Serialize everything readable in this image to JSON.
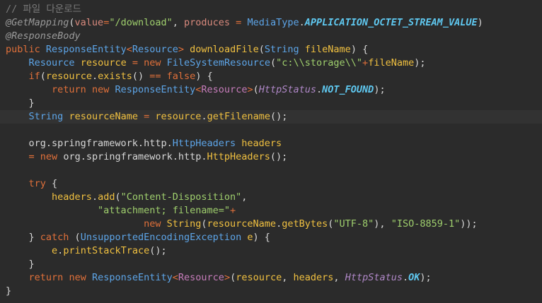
{
  "editor": {
    "lines": [
      [
        {
          "c": "t-comment",
          "t": "// 파일 다운로드"
        }
      ],
      [
        {
          "c": "t-annot",
          "t": "@GetMapping"
        },
        {
          "c": "t-plain",
          "t": "("
        },
        {
          "c": "t-param",
          "t": "value"
        },
        {
          "c": "t-op",
          "t": "="
        },
        {
          "c": "t-str",
          "t": "\"/download\""
        },
        {
          "c": "t-plain",
          "t": ", "
        },
        {
          "c": "t-param",
          "t": "produces"
        },
        {
          "c": "t-plain",
          "t": " "
        },
        {
          "c": "t-op",
          "t": "="
        },
        {
          "c": "t-plain",
          "t": " "
        },
        {
          "c": "t-type",
          "t": "MediaType"
        },
        {
          "c": "t-plain",
          "t": "."
        },
        {
          "c": "t-const",
          "t": "APPLICATION_OCTET_STREAM_VALUE"
        },
        {
          "c": "t-plain",
          "t": ")"
        }
      ],
      [
        {
          "c": "t-annot",
          "t": "@ResponseBody"
        }
      ],
      [
        {
          "c": "t-kw",
          "t": "public"
        },
        {
          "c": "t-plain",
          "t": " "
        },
        {
          "c": "t-type",
          "t": "ResponseEntity"
        },
        {
          "c": "t-op",
          "t": "<"
        },
        {
          "c": "t-type",
          "t": "Resource"
        },
        {
          "c": "t-op",
          "t": ">"
        },
        {
          "c": "t-plain",
          "t": " "
        },
        {
          "c": "t-method",
          "t": "downloadFile"
        },
        {
          "c": "t-plain",
          "t": "("
        },
        {
          "c": "t-type",
          "t": "String"
        },
        {
          "c": "t-plain",
          "t": " "
        },
        {
          "c": "t-var",
          "t": "fileName"
        },
        {
          "c": "t-plain",
          "t": ") {"
        }
      ],
      [
        {
          "c": "t-plain",
          "t": "    "
        },
        {
          "c": "t-type",
          "t": "Resource"
        },
        {
          "c": "t-plain",
          "t": " "
        },
        {
          "c": "t-var",
          "t": "resource"
        },
        {
          "c": "t-plain",
          "t": " "
        },
        {
          "c": "t-op",
          "t": "="
        },
        {
          "c": "t-plain",
          "t": " "
        },
        {
          "c": "t-kw",
          "t": "new"
        },
        {
          "c": "t-plain",
          "t": " "
        },
        {
          "c": "t-type",
          "t": "FileSystemResource"
        },
        {
          "c": "t-plain",
          "t": "("
        },
        {
          "c": "t-str",
          "t": "\"c:\\\\storage\\\\\""
        },
        {
          "c": "t-op",
          "t": "+"
        },
        {
          "c": "t-var",
          "t": "fileName"
        },
        {
          "c": "t-plain",
          "t": ");"
        }
      ],
      [
        {
          "c": "t-plain",
          "t": "    "
        },
        {
          "c": "t-kw",
          "t": "if"
        },
        {
          "c": "t-plain",
          "t": "("
        },
        {
          "c": "t-var",
          "t": "resource"
        },
        {
          "c": "t-plain",
          "t": "."
        },
        {
          "c": "t-method",
          "t": "exists"
        },
        {
          "c": "t-plain",
          "t": "() "
        },
        {
          "c": "t-op",
          "t": "=="
        },
        {
          "c": "t-plain",
          "t": " "
        },
        {
          "c": "t-kw",
          "t": "false"
        },
        {
          "c": "t-plain",
          "t": ") {"
        }
      ],
      [
        {
          "c": "t-plain",
          "t": "        "
        },
        {
          "c": "t-kw",
          "t": "return"
        },
        {
          "c": "t-plain",
          "t": " "
        },
        {
          "c": "t-kw",
          "t": "new"
        },
        {
          "c": "t-plain",
          "t": " "
        },
        {
          "c": "t-type",
          "t": "ResponseEntity"
        },
        {
          "c": "t-op",
          "t": "<"
        },
        {
          "c": "t-generic",
          "t": "Resource"
        },
        {
          "c": "t-op",
          "t": ">"
        },
        {
          "c": "t-plain",
          "t": "("
        },
        {
          "c": "t-static",
          "t": "HttpStatus"
        },
        {
          "c": "t-plain",
          "t": "."
        },
        {
          "c": "t-const",
          "t": "NOT_FOUND"
        },
        {
          "c": "t-plain",
          "t": ");"
        }
      ],
      [
        {
          "c": "t-plain",
          "t": "    }"
        }
      ],
      [
        {
          "c": "t-plain",
          "t": "    "
        },
        {
          "c": "t-type",
          "t": "String"
        },
        {
          "c": "t-plain",
          "t": " "
        },
        {
          "c": "t-var",
          "t": "resourceName"
        },
        {
          "c": "t-plain",
          "t": " "
        },
        {
          "c": "t-op",
          "t": "="
        },
        {
          "c": "t-plain",
          "t": " "
        },
        {
          "c": "t-var",
          "t": "resource"
        },
        {
          "c": "t-plain",
          "t": "."
        },
        {
          "c": "t-method",
          "t": "getFilename"
        },
        {
          "c": "t-plain",
          "t": "();"
        }
      ],
      [
        {
          "c": "t-plain",
          "t": ""
        }
      ],
      [
        {
          "c": "t-plain",
          "t": "    org.springframework.http."
        },
        {
          "c": "t-type",
          "t": "HttpHeaders"
        },
        {
          "c": "t-plain",
          "t": " "
        },
        {
          "c": "t-var",
          "t": "headers"
        }
      ],
      [
        {
          "c": "t-plain",
          "t": "    "
        },
        {
          "c": "t-op",
          "t": "="
        },
        {
          "c": "t-plain",
          "t": " "
        },
        {
          "c": "t-kw",
          "t": "new"
        },
        {
          "c": "t-plain",
          "t": " org.springframework.http."
        },
        {
          "c": "t-method",
          "t": "HttpHeaders"
        },
        {
          "c": "t-plain",
          "t": "();"
        }
      ],
      [
        {
          "c": "t-plain",
          "t": ""
        }
      ],
      [
        {
          "c": "t-plain",
          "t": "    "
        },
        {
          "c": "t-kw",
          "t": "try"
        },
        {
          "c": "t-plain",
          "t": " {"
        }
      ],
      [
        {
          "c": "t-plain",
          "t": "        "
        },
        {
          "c": "t-var",
          "t": "headers"
        },
        {
          "c": "t-plain",
          "t": "."
        },
        {
          "c": "t-method",
          "t": "add"
        },
        {
          "c": "t-plain",
          "t": "("
        },
        {
          "c": "t-str",
          "t": "\"Content-Disposition\""
        },
        {
          "c": "t-plain",
          "t": ","
        }
      ],
      [
        {
          "c": "t-plain",
          "t": "                "
        },
        {
          "c": "t-str",
          "t": "\"attachment; filename=\""
        },
        {
          "c": "t-op",
          "t": "+"
        }
      ],
      [
        {
          "c": "t-plain",
          "t": "                        "
        },
        {
          "c": "t-kw",
          "t": "new"
        },
        {
          "c": "t-plain",
          "t": " "
        },
        {
          "c": "t-method",
          "t": "String"
        },
        {
          "c": "t-plain",
          "t": "("
        },
        {
          "c": "t-var",
          "t": "resourceName"
        },
        {
          "c": "t-plain",
          "t": "."
        },
        {
          "c": "t-method",
          "t": "getBytes"
        },
        {
          "c": "t-plain",
          "t": "("
        },
        {
          "c": "t-str",
          "t": "\"UTF-8\""
        },
        {
          "c": "t-plain",
          "t": "), "
        },
        {
          "c": "t-str",
          "t": "\"ISO-8859-1\""
        },
        {
          "c": "t-plain",
          "t": "));"
        }
      ],
      [
        {
          "c": "t-plain",
          "t": "    } "
        },
        {
          "c": "t-kw",
          "t": "catch"
        },
        {
          "c": "t-plain",
          "t": " ("
        },
        {
          "c": "t-type",
          "t": "UnsupportedEncodingException"
        },
        {
          "c": "t-plain",
          "t": " "
        },
        {
          "c": "t-var",
          "t": "e"
        },
        {
          "c": "t-plain",
          "t": ") {"
        }
      ],
      [
        {
          "c": "t-plain",
          "t": "        "
        },
        {
          "c": "t-var",
          "t": "e"
        },
        {
          "c": "t-plain",
          "t": "."
        },
        {
          "c": "t-method",
          "t": "printStackTrace"
        },
        {
          "c": "t-plain",
          "t": "();"
        }
      ],
      [
        {
          "c": "t-plain",
          "t": "    }"
        }
      ],
      [
        {
          "c": "t-plain",
          "t": "    "
        },
        {
          "c": "t-kw",
          "t": "return"
        },
        {
          "c": "t-plain",
          "t": " "
        },
        {
          "c": "t-kw",
          "t": "new"
        },
        {
          "c": "t-plain",
          "t": " "
        },
        {
          "c": "t-type",
          "t": "ResponseEntity"
        },
        {
          "c": "t-op",
          "t": "<"
        },
        {
          "c": "t-generic",
          "t": "Resource"
        },
        {
          "c": "t-op",
          "t": ">"
        },
        {
          "c": "t-plain",
          "t": "("
        },
        {
          "c": "t-var",
          "t": "resource"
        },
        {
          "c": "t-plain",
          "t": ", "
        },
        {
          "c": "t-var",
          "t": "headers"
        },
        {
          "c": "t-plain",
          "t": ", "
        },
        {
          "c": "t-static",
          "t": "HttpStatus"
        },
        {
          "c": "t-plain",
          "t": "."
        },
        {
          "c": "t-const",
          "t": "OK"
        },
        {
          "c": "t-plain",
          "t": ");"
        }
      ],
      [
        {
          "c": "t-plain",
          "t": "}"
        }
      ]
    ],
    "current_line": 8
  },
  "colors": {
    "background": "#2b2b2b",
    "current_line": "#323232",
    "keyword": "#e0703a",
    "type": "#5da5e8",
    "string": "#9fcf6d",
    "variable": "#f0c040",
    "comment": "#7a7a7a"
  }
}
